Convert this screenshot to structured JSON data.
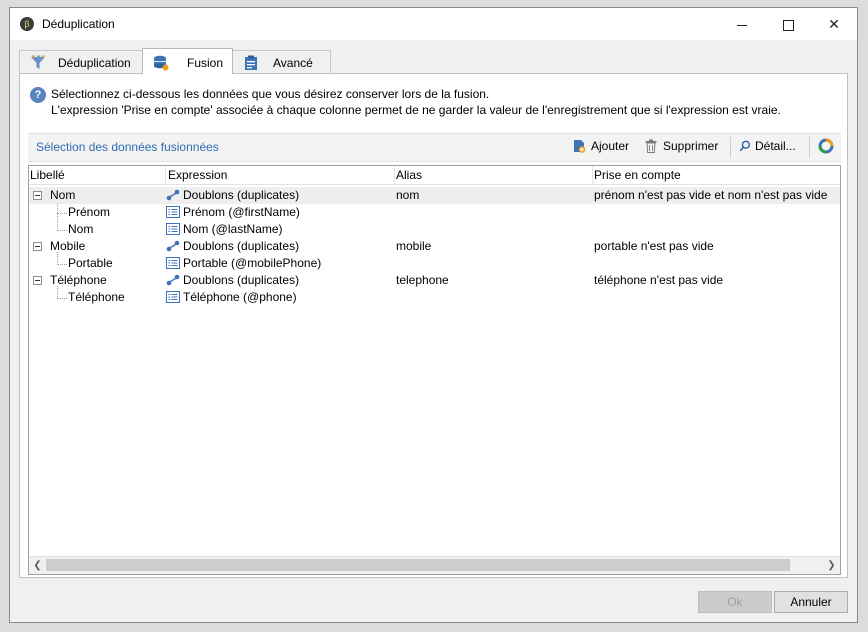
{
  "window": {
    "title": "Déduplication"
  },
  "tabs": [
    {
      "label": "Déduplication"
    },
    {
      "label": "Fusion"
    },
    {
      "label": "Avancé"
    }
  ],
  "info": {
    "line1": "Sélectionnez ci-dessous les données que vous désirez conserver lors de la fusion.",
    "line2": "L'expression 'Prise en compte' associée à chaque colonne permet de ne garder la valeur de l'enregistrement que si l'expression est vraie."
  },
  "toolbar": {
    "section_title": "Sélection des données fusionnées",
    "add_label": "Ajouter",
    "delete_label": "Supprimer",
    "detail_label": "Détail..."
  },
  "grid": {
    "columns": [
      "Libellé",
      "Expression",
      "Alias",
      "Prise en compte"
    ],
    "rows": [
      {
        "label": "Nom",
        "expression": "Doublons (duplicates)",
        "alias": "nom",
        "condition": "prénom n'est pas vide et nom n'est pas vide",
        "group": true,
        "icon": "link-icon"
      },
      {
        "label": "Prénom",
        "expression": "Prénom (@firstName)",
        "alias": "",
        "condition": "",
        "group": false,
        "icon": "field-icon"
      },
      {
        "label": "Nom",
        "expression": "Nom (@lastName)",
        "alias": "",
        "condition": "",
        "group": false,
        "icon": "field-icon"
      },
      {
        "label": "Mobile",
        "expression": "Doublons (duplicates)",
        "alias": "mobile",
        "condition": "portable n'est pas vide",
        "group": true,
        "icon": "link-icon"
      },
      {
        "label": "Portable",
        "expression": "Portable (@mobilePhone)",
        "alias": "",
        "condition": "",
        "group": false,
        "icon": "field-icon"
      },
      {
        "label": "Téléphone",
        "expression": "Doublons (duplicates)",
        "alias": "telephone",
        "condition": "téléphone n'est pas vide",
        "group": true,
        "icon": "link-icon"
      },
      {
        "label": "Téléphone",
        "expression": "Téléphone (@phone)",
        "alias": "",
        "condition": "",
        "group": false,
        "icon": "field-icon"
      }
    ]
  },
  "buttons": {
    "ok_label": "Ok",
    "cancel_label": "Annuler"
  }
}
